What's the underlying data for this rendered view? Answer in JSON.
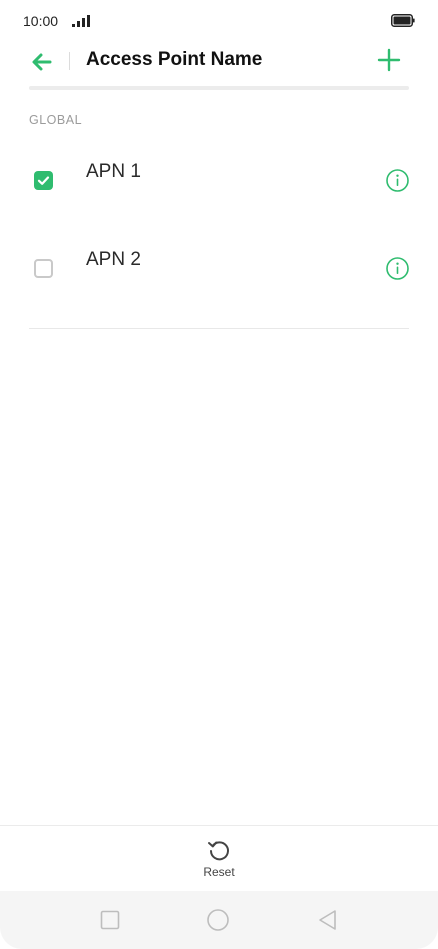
{
  "status_bar": {
    "time": "10:00",
    "signal_icon": "signal-icon",
    "battery_icon": "battery-icon"
  },
  "app_bar": {
    "title": "Access Point Name",
    "back_icon": "back-arrow-icon",
    "add_icon": "plus-icon"
  },
  "section": {
    "title": "GLOBAL"
  },
  "apn_list": [
    {
      "label": "APN 1",
      "checked": true
    },
    {
      "label": "APN 2",
      "checked": false
    }
  ],
  "toolbar": {
    "reset_label": "Reset",
    "reset_icon": "reset-icon"
  },
  "nav_bar": {
    "recents_icon": "square-icon",
    "home_icon": "circle-icon",
    "back_icon": "triangle-back-icon"
  },
  "colors": {
    "accent": "#2fbc6f",
    "text": "#222222",
    "section": "#9b9b9b"
  }
}
